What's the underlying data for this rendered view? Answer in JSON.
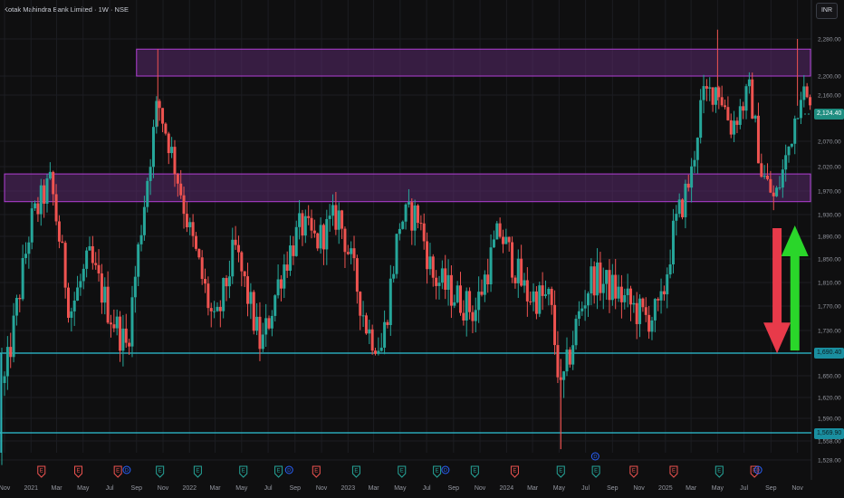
{
  "header": {
    "title": "Kotak Mahindra Bank Limited · 1W · NSE",
    "currency_button": "INR"
  },
  "price_tags": {
    "last": "2,124.40",
    "support_upper": "1,690.40",
    "support_lower": "1,569.90"
  },
  "colors": {
    "background": "#0f0f10",
    "grid": "#1c1d22",
    "up": "#26a69a",
    "down": "#ef5350",
    "zone_stroke": "#b23fd6",
    "zone_fill": "#5a2a6b",
    "support_line": "#2ec4d6",
    "arrow_down": "#e83a4a",
    "arrow_up": "#2ad62a",
    "axis_text": "#9598a1",
    "last_price_bg": "#1e8d80"
  },
  "chart_data": {
    "type": "candlestick",
    "ylim": [
      1500,
      2300
    ],
    "y_ticks": [
      {
        "value": 2280,
        "label": "2,280.00"
      },
      {
        "value": 2200,
        "label": "2,200.00"
      },
      {
        "value": 2160,
        "label": "2,160.00"
      },
      {
        "value": 2070,
        "label": "2,070.00"
      },
      {
        "value": 2020,
        "label": "2,020.00"
      },
      {
        "value": 1970,
        "label": "1,970.00"
      },
      {
        "value": 1930,
        "label": "1,930.00"
      },
      {
        "value": 1890,
        "label": "1,890.00"
      },
      {
        "value": 1850,
        "label": "1,850.00"
      },
      {
        "value": 1810,
        "label": "1,810.00"
      },
      {
        "value": 1770,
        "label": "1,770.00"
      },
      {
        "value": 1730,
        "label": "1,730.00"
      },
      {
        "value": 1650,
        "label": "1,650.00"
      },
      {
        "value": 1620,
        "label": "1,620.00"
      },
      {
        "value": 1590,
        "label": "1,590.00"
      },
      {
        "value": 1558,
        "label": "1,558.00"
      },
      {
        "value": 1528,
        "label": "1,528.00"
      }
    ],
    "x_labels": [
      {
        "label": "Nov",
        "date": "2020-11-01"
      },
      {
        "label": "2021",
        "date": "2021-01-01"
      },
      {
        "label": "Mar",
        "date": "2021-03-01"
      },
      {
        "label": "May",
        "date": "2021-05-01"
      },
      {
        "label": "Jul",
        "date": "2021-07-01"
      },
      {
        "label": "Sep",
        "date": "2021-09-01"
      },
      {
        "label": "Nov",
        "date": "2021-11-01"
      },
      {
        "label": "2022",
        "date": "2022-01-01"
      },
      {
        "label": "Mar",
        "date": "2022-03-01"
      },
      {
        "label": "May",
        "date": "2022-05-01"
      },
      {
        "label": "Jul",
        "date": "2022-07-01"
      },
      {
        "label": "Sep",
        "date": "2022-09-01"
      },
      {
        "label": "Nov",
        "date": "2022-11-01"
      },
      {
        "label": "2023",
        "date": "2023-01-01"
      },
      {
        "label": "Mar",
        "date": "2023-03-01"
      },
      {
        "label": "May",
        "date": "2023-05-01"
      },
      {
        "label": "Jul",
        "date": "2023-07-01"
      },
      {
        "label": "Sep",
        "date": "2023-09-01"
      },
      {
        "label": "Nov",
        "date": "2023-11-01"
      },
      {
        "label": "2024",
        "date": "2024-01-01"
      },
      {
        "label": "Mar",
        "date": "2024-03-01"
      },
      {
        "label": "May",
        "date": "2024-05-01"
      },
      {
        "label": "Jul",
        "date": "2024-07-01"
      },
      {
        "label": "Sep",
        "date": "2024-09-01"
      },
      {
        "label": "Nov",
        "date": "2024-11-01"
      },
      {
        "label": "2025",
        "date": "2025-01-01"
      },
      {
        "label": "Mar",
        "date": "2025-03-01"
      },
      {
        "label": "May",
        "date": "2025-05-01"
      },
      {
        "label": "Jul",
        "date": "2025-07-01"
      },
      {
        "label": "Sep",
        "date": "2025-09-01"
      },
      {
        "label": "Nov",
        "date": "2025-11-01"
      }
    ],
    "zones": [
      {
        "from_date": "2021-09-01",
        "to_date": "2025-12-01",
        "low": 2200,
        "high": 2258
      },
      {
        "from_date": "2020-11-01",
        "to_date": "2025-12-01",
        "low": 1952,
        "high": 2005
      }
    ],
    "lines": [
      {
        "value": 1690.4,
        "label": "1,690.40"
      },
      {
        "value": 1569.9,
        "label": "1,569.90"
      }
    ],
    "last_price": {
      "value": 2124.4,
      "label": "2,124.40"
    },
    "arrows": [
      {
        "direction": "down",
        "date": "2025-09-15",
        "from": 1905,
        "to": 1690
      },
      {
        "direction": "up",
        "date": "2025-10-26",
        "from": 1695,
        "to": 1910
      }
    ],
    "events": [
      {
        "date": "2021-04-20",
        "kind": "E",
        "color": "#ef5350"
      },
      {
        "date": "2021-07-20",
        "kind": "E",
        "color": "#ef5350"
      },
      {
        "date": "2021-10-25",
        "kind": "E",
        "color": "#26a69a"
      },
      {
        "date": "2022-01-20",
        "kind": "E",
        "color": "#26a69a"
      },
      {
        "date": "2022-05-05",
        "kind": "E",
        "color": "#26a69a"
      },
      {
        "date": "2022-07-25",
        "kind": "E",
        "color": "#26a69a"
      },
      {
        "date": "2022-10-20",
        "kind": "E",
        "color": "#ef5350"
      },
      {
        "date": "2023-01-20",
        "kind": "E",
        "color": "#26a69a"
      },
      {
        "date": "2023-05-05",
        "kind": "E",
        "color": "#26a69a"
      },
      {
        "date": "2023-07-25",
        "kind": "E",
        "color": "#26a69a"
      },
      {
        "date": "2023-10-20",
        "kind": "E",
        "color": "#26a69a"
      },
      {
        "date": "2024-01-20",
        "kind": "E",
        "color": "#ef5350"
      },
      {
        "date": "2024-05-05",
        "kind": "E",
        "color": "#26a69a"
      },
      {
        "date": "2024-07-25",
        "kind": "E",
        "color": "#26a69a"
      },
      {
        "date": "2024-10-20",
        "kind": "E",
        "color": "#ef5350"
      },
      {
        "date": "2025-01-20",
        "kind": "E",
        "color": "#ef5350"
      },
      {
        "date": "2025-05-05",
        "kind": "E",
        "color": "#26a69a"
      },
      {
        "date": "2025-07-25",
        "kind": "E",
        "color": "#ef5350"
      },
      {
        "date": "2021-01-25",
        "kind": "E",
        "color": "#ef5350"
      }
    ],
    "dividends": [
      {
        "date": "2021-08-01",
        "kind": "D",
        "color": "#2962ff"
      },
      {
        "date": "2022-08-10",
        "kind": "D",
        "color": "#2962ff"
      },
      {
        "date": "2023-08-05",
        "kind": "D",
        "color": "#2962ff"
      },
      {
        "date": "2024-07-15",
        "kind": "D",
        "color": "#2962ff",
        "raised": true
      },
      {
        "date": "2025-07-25",
        "kind": "D",
        "color": "#2962ff"
      }
    ],
    "anchors": [
      {
        "date": "2020-11-01",
        "price": 1640
      },
      {
        "date": "2021-01-01",
        "price": 1915
      },
      {
        "date": "2021-02-15",
        "price": 1990
      },
      {
        "date": "2021-04-01",
        "price": 1760
      },
      {
        "date": "2021-05-15",
        "price": 1850
      },
      {
        "date": "2021-07-01",
        "price": 1760
      },
      {
        "date": "2021-08-10",
        "price": 1700
      },
      {
        "date": "2021-09-20",
        "price": 1960
      },
      {
        "date": "2021-10-20",
        "price": 2150
      },
      {
        "date": "2021-11-20",
        "price": 2050
      },
      {
        "date": "2022-01-01",
        "price": 1900
      },
      {
        "date": "2022-03-01",
        "price": 1730
      },
      {
        "date": "2022-04-15",
        "price": 1870
      },
      {
        "date": "2022-06-15",
        "price": 1700
      },
      {
        "date": "2022-08-01",
        "price": 1830
      },
      {
        "date": "2022-09-15",
        "price": 1910
      },
      {
        "date": "2022-10-20",
        "price": 1880
      },
      {
        "date": "2022-12-10",
        "price": 1930
      },
      {
        "date": "2023-02-15",
        "price": 1730
      },
      {
        "date": "2023-03-20",
        "price": 1700
      },
      {
        "date": "2023-05-01",
        "price": 1920
      },
      {
        "date": "2023-06-10",
        "price": 1930
      },
      {
        "date": "2023-07-15",
        "price": 1820
      },
      {
        "date": "2023-09-01",
        "price": 1790
      },
      {
        "date": "2023-10-20",
        "price": 1760
      },
      {
        "date": "2023-12-15",
        "price": 1900
      },
      {
        "date": "2024-02-15",
        "price": 1790
      },
      {
        "date": "2024-04-10",
        "price": 1780
      },
      {
        "date": "2024-05-05",
        "price": 1620
      },
      {
        "date": "2024-06-10",
        "price": 1740
      },
      {
        "date": "2024-07-15",
        "price": 1820
      },
      {
        "date": "2024-09-01",
        "price": 1800
      },
      {
        "date": "2024-10-15",
        "price": 1770
      },
      {
        "date": "2024-11-15",
        "price": 1750
      },
      {
        "date": "2024-12-20",
        "price": 1760
      },
      {
        "date": "2025-01-20",
        "price": 1900
      },
      {
        "date": "2025-03-01",
        "price": 2000
      },
      {
        "date": "2025-03-25",
        "price": 2150
      },
      {
        "date": "2025-05-01",
        "price": 2180
      },
      {
        "date": "2025-06-01",
        "price": 2100
      },
      {
        "date": "2025-07-15",
        "price": 2170
      },
      {
        "date": "2025-08-10",
        "price": 2010
      },
      {
        "date": "2025-09-10",
        "price": 1950
      },
      {
        "date": "2025-10-10",
        "price": 2050
      },
      {
        "date": "2025-11-10",
        "price": 2180
      },
      {
        "date": "2025-12-01",
        "price": 2124
      }
    ]
  }
}
